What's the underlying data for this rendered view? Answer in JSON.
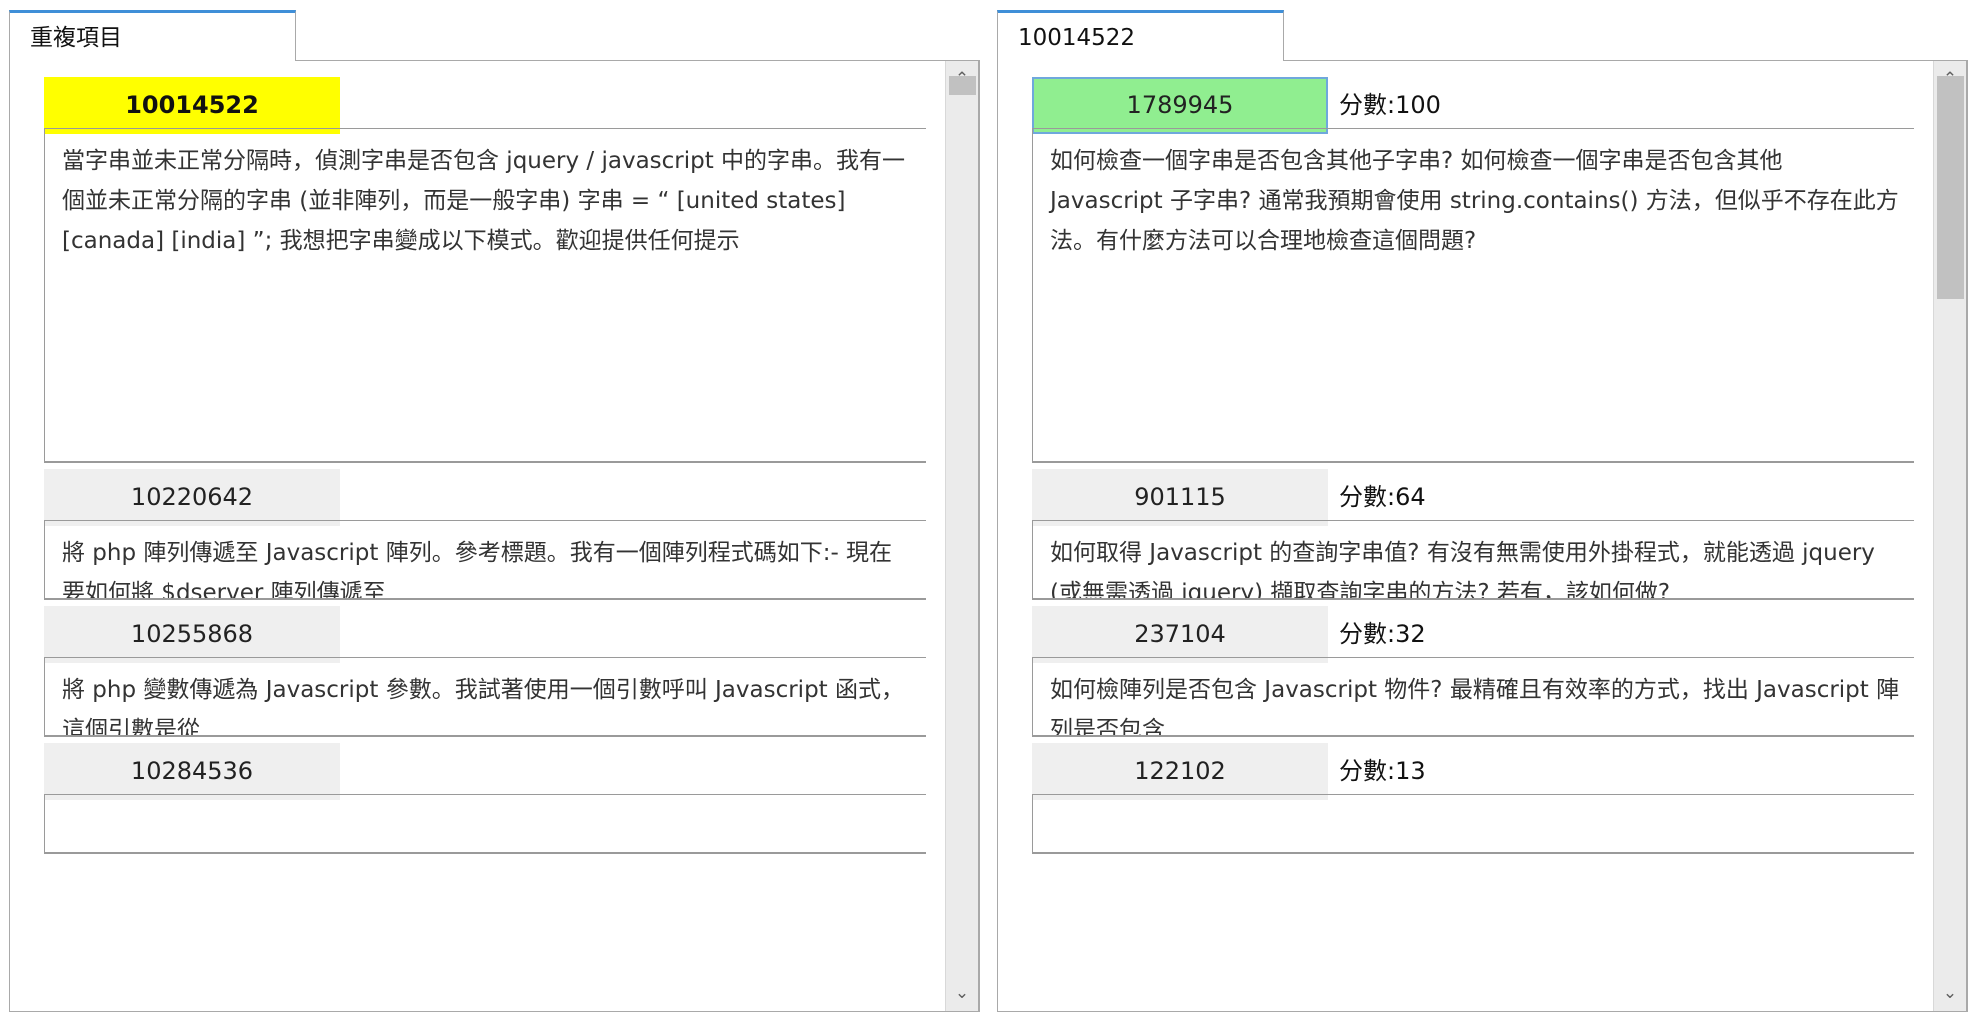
{
  "left_panel": {
    "tab_label": "重複項目",
    "items": [
      {
        "id": "10014522",
        "text": "當字串並未正常分隔時，偵測字串是否包含 jquery / javascript 中的字串。我有一個並未正常分隔的字串 (並非陣列，而是一般字串) 字串 = “ [united states] [canada] [india] ”; 我想把字串變成以下模式。歡迎提供任何提示"
      },
      {
        "id": "10220642",
        "text": "將 php 陣列傳遞至 Javascript 陣列。參考標題。我有一個陣列程式碼如下:- 現在要如何將 $dserver 陣列傳遞至"
      },
      {
        "id": "10255868",
        "text": "將 php 變數傳遞為 Javascript 參數。我試著使用一個引數呼叫 Javascript 函式，這個引數是從"
      },
      {
        "id": "10284536",
        "text": ""
      }
    ]
  },
  "right_panel": {
    "tab_label": "10014522",
    "items": [
      {
        "id": "1789945",
        "score": "分數:100",
        "text": "如何檢查一個字串是否包含其他子字串? 如何檢查一個字串是否包含其他 Javascript 子字串? 通常我預期會使用 string.contains() 方法，但似乎不存在此方法。有什麼方法可以合理地檢查這個問題?"
      },
      {
        "id": "901115",
        "score": "分數:64",
        "text": "如何取得 Javascript 的查詢字串值? 有沒有無需使用外掛程式，就能透過 jquery (或無需透過 jquery) 擷取查詢字串的方法? 若有，該如何做?"
      },
      {
        "id": "237104",
        "score": "分數:32",
        "text": "如何檢陣列是否包含 Javascript 物件? 最精確且有效率的方式，找出 Javascript 陣列是否包含"
      },
      {
        "id": "122102",
        "score": "分數:13",
        "text": ""
      }
    ]
  },
  "colors": {
    "selected_left": "#ffff00",
    "selected_right": "#90ee90",
    "tab_accent": "#3f8fd8",
    "id_box_bg": "#efefef"
  },
  "icons": {
    "scroll_up": "chevron-up-icon",
    "scroll_down": "chevron-down-icon"
  }
}
